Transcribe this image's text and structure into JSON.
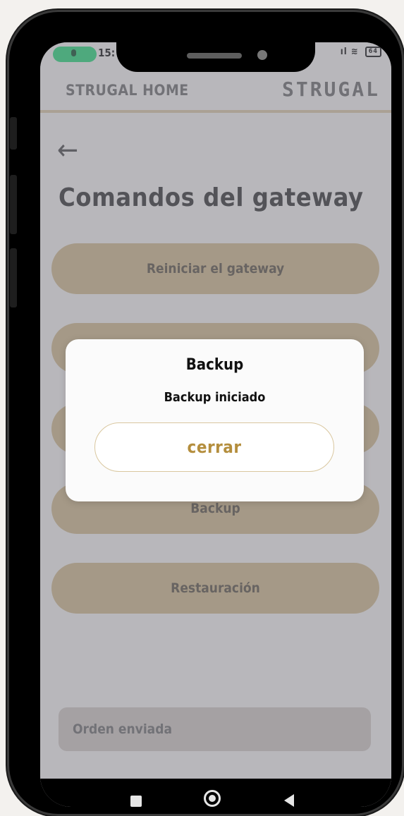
{
  "status_bar": {
    "time": "15:",
    "signal": "ıl",
    "wifi": "wifi-icon",
    "battery": "64"
  },
  "app_bar": {
    "title": "STRUGAL HOME",
    "logo": "STRUGAL"
  },
  "page": {
    "back": "←",
    "title": "Comandos del gateway"
  },
  "commands": [
    {
      "label": "Reiniciar el gateway"
    },
    {
      "label": ""
    },
    {
      "label": ""
    },
    {
      "label": "Backup"
    },
    {
      "label": "Restauración"
    }
  ],
  "status_field": {
    "text": "Orden enviada"
  },
  "dialog": {
    "title": "Backup",
    "message": "Backup iniciado",
    "button": "cerrar"
  },
  "colors": {
    "accent": "#cfb98c",
    "accent_text": "#b48e3d",
    "mic_indicator": "#29d67a"
  }
}
